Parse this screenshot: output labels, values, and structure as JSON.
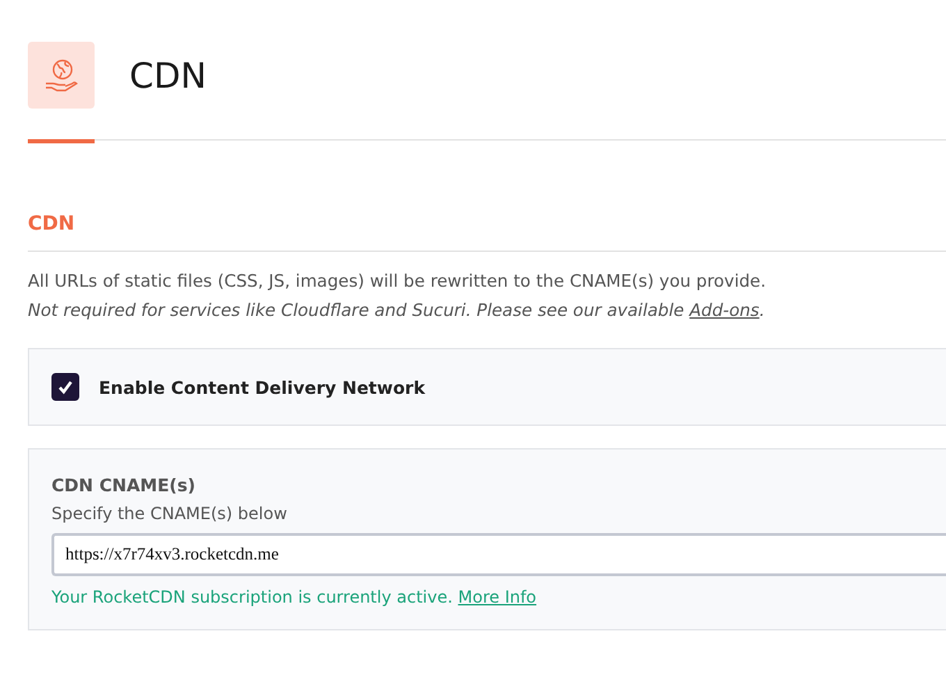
{
  "page": {
    "title": "CDN",
    "tab_selected": true
  },
  "section": {
    "title": "CDN",
    "description": "All URLs of static files (CSS, JS, images) will be rewritten to the CNAME(s) you provide.",
    "note": {
      "text": "Not required for services like Cloudflare and Sucuri. Please see our available ",
      "link": "Add-ons",
      "end": "."
    }
  },
  "enable_option": {
    "label": "Enable Content Delivery Network",
    "checked": true
  },
  "cname": {
    "title": "CDN CNAME(s)",
    "hint": "Specify the CNAME(s) below",
    "value": "https://x7r74xv3.rocketcdn.me",
    "status": {
      "text": "Your RocketCDN subscription is currently active. ",
      "link": "More Info"
    }
  }
}
